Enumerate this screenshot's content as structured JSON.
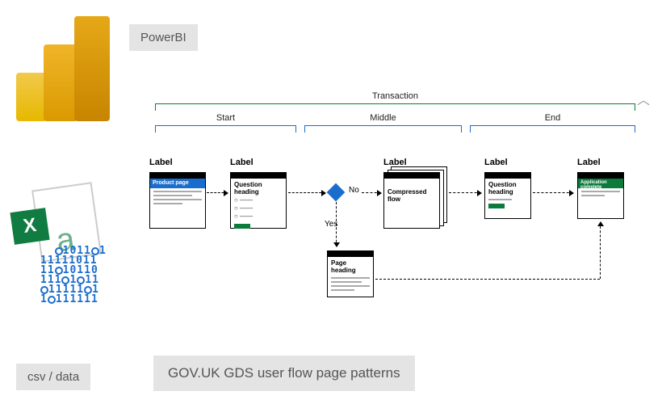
{
  "tags": {
    "powerbi": "PowerBI",
    "csv": "csv / data",
    "gds": "GOV.UK GDS user flow page patterns"
  },
  "diagram": {
    "transaction_label": "Transaction",
    "phases": {
      "start": "Start",
      "middle": "Middle",
      "end": "End"
    },
    "generic_card_label": "Label",
    "cards": {
      "product": {
        "title": "Product page"
      },
      "question1": {
        "title": "Question heading"
      },
      "compressed": {
        "title": "Compressed flow"
      },
      "question2": {
        "title": "Question heading"
      },
      "complete": {
        "title": "Application complete"
      },
      "page": {
        "title": "Page heading"
      }
    },
    "decision": {
      "no": "No",
      "yes": "Yes"
    }
  }
}
